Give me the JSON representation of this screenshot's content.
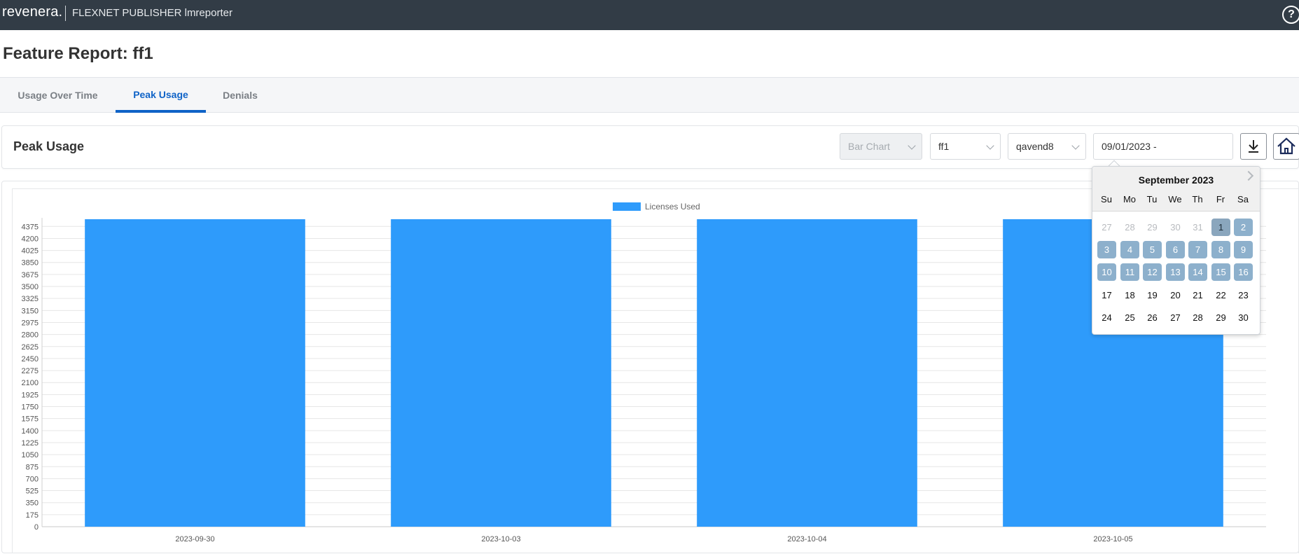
{
  "topbar": {
    "logo": "revenera.",
    "app_title": "FLEXNET PUBLISHER lmreporter",
    "help": "?"
  },
  "page": {
    "title": "Feature Report: ff1"
  },
  "tabs": [
    {
      "label": "Usage Over Time",
      "active": false
    },
    {
      "label": "Peak Usage",
      "active": true
    },
    {
      "label": "Denials",
      "active": false
    }
  ],
  "panel": {
    "title": "Peak Usage",
    "chart_type_select": "Bar Chart",
    "feature_select": "ff1",
    "vendor_select": "qavend8",
    "date_range": "09/01/2023 -",
    "download_icon": "download-icon",
    "home_icon": "home-icon"
  },
  "calendar": {
    "month": "September 2023",
    "weekdays": [
      "Su",
      "Mo",
      "Tu",
      "We",
      "Th",
      "Fr",
      "Sa"
    ],
    "weeks": [
      [
        "27",
        "28",
        "29",
        "30",
        "31",
        "1",
        "2"
      ],
      [
        "3",
        "4",
        "5",
        "6",
        "7",
        "8",
        "9"
      ],
      [
        "10",
        "11",
        "12",
        "13",
        "14",
        "15",
        "16"
      ],
      [
        "17",
        "18",
        "19",
        "20",
        "21",
        "22",
        "23"
      ],
      [
        "24",
        "25",
        "26",
        "27",
        "28",
        "29",
        "30"
      ]
    ],
    "outside_days": [
      "27",
      "28",
      "29",
      "30",
      "31"
    ],
    "selected_start": "1",
    "range_through": "16"
  },
  "chart_data": {
    "type": "bar",
    "categories": [
      "2023-09-30",
      "2023-10-03",
      "2023-10-04",
      "2023-10-05"
    ],
    "series": [
      {
        "name": "Licenses Used",
        "color": "#2e9bfb",
        "values": [
          4480,
          4480,
          4480,
          4480
        ]
      }
    ],
    "ylim": [
      0,
      4480
    ],
    "yticks": [
      0,
      175,
      350,
      525,
      700,
      875,
      1050,
      1225,
      1400,
      1575,
      1750,
      1925,
      2100,
      2275,
      2450,
      2625,
      2800,
      2975,
      3150,
      3325,
      3500,
      3675,
      3850,
      4025,
      4200,
      4375
    ],
    "legend": "top-center",
    "grid": true
  }
}
